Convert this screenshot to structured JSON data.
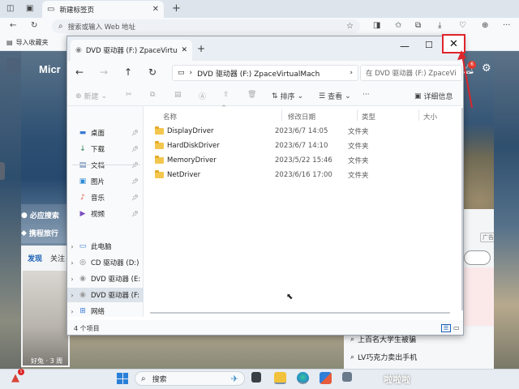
{
  "browser": {
    "tab_title": "新建标签页",
    "address_placeholder": "搜索或输入 Web 地址",
    "favorites_import": "导入收藏夹"
  },
  "page": {
    "logo_text": "Micr",
    "search_tag": "必应搜索",
    "travel_tag": "携程旅行",
    "tabs": [
      "发现",
      "关注"
    ],
    "ad_tag": "广告",
    "card_caption": "好兔 · 3 周",
    "notification_count": "6",
    "news": [
      "上百名大学生被骗",
      "LV巧克力卖出手机"
    ]
  },
  "explorer": {
    "tab_title": "DVD 驱动器 (F:) ZpaceVirtualMachine",
    "path_text": "DVD 驱动器 (F:) ZpaceVirtualMach",
    "search_placeholder": "在 DVD 驱动器 (F:) ZpaceVirtualMachine 中搜索",
    "toolbar": {
      "new": "新建",
      "sort": "排序",
      "view": "查看",
      "more": "···",
      "details": "详细信息"
    },
    "sidebar": [
      {
        "label": "桌面",
        "icon": "desktop-icon",
        "pinned": true
      },
      {
        "label": "下载",
        "icon": "download-icon",
        "pinned": true
      },
      {
        "label": "文档",
        "icon": "document-icon",
        "pinned": true
      },
      {
        "label": "图片",
        "icon": "picture-icon",
        "pinned": true
      },
      {
        "label": "音乐",
        "icon": "music-icon",
        "pinned": true
      },
      {
        "label": "视频",
        "icon": "video-icon",
        "pinned": true
      }
    ],
    "drives": [
      {
        "label": "此电脑",
        "icon": "computer-icon"
      },
      {
        "label": "CD 驱动器 (D:)",
        "icon": "cd-drive-icon"
      },
      {
        "label": "DVD 驱动器 (E:",
        "icon": "dvd-drive-icon"
      },
      {
        "label": "DVD 驱动器 (F:",
        "icon": "dvd-drive-icon",
        "selected": true
      },
      {
        "label": "网络",
        "icon": "network-icon"
      }
    ],
    "columns": {
      "name": "名称",
      "date": "修改日期",
      "type": "类型",
      "size": "大小"
    },
    "files": [
      {
        "name": "DisplayDriver",
        "date": "2023/6/7 14:05",
        "type": "文件夹"
      },
      {
        "name": "HardDiskDriver",
        "date": "2023/6/7 14:10",
        "type": "文件夹"
      },
      {
        "name": "MemoryDriver",
        "date": "2023/5/22 15:46",
        "type": "文件夹"
      },
      {
        "name": "NetDriver",
        "date": "2023/6/16 17:00",
        "type": "文件夹"
      }
    ],
    "status": "4 个项目"
  },
  "taskbar": {
    "search_label": "搜索",
    "notification_count": "1",
    "watermark": "啦啦啦"
  },
  "colors": {
    "accent": "#1b5fb4",
    "highlight_box": "#e0242b",
    "folder": "#f3c64d"
  }
}
